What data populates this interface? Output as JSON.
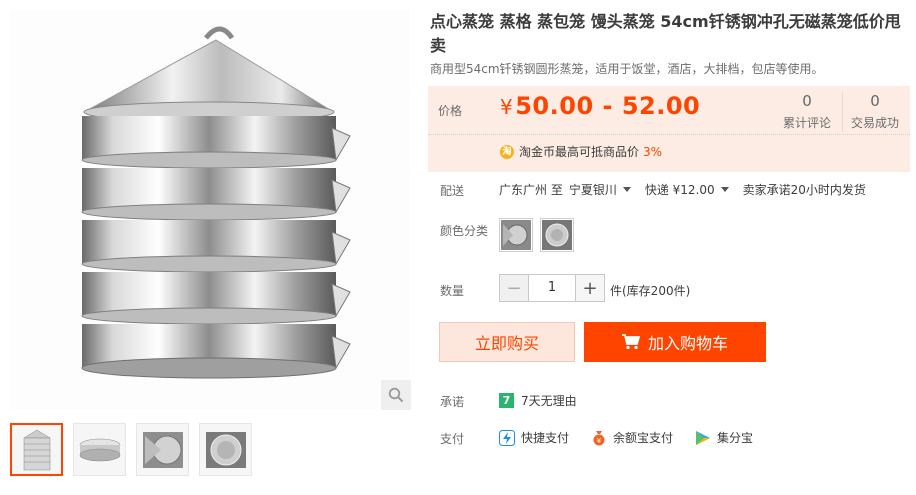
{
  "product": {
    "title": "点心蒸笼 蒸格 蒸包笼 馒头蒸笼 54cm钎锈钢冲孔无磁蒸笼低价甩卖",
    "subtitle": "商用型54cm钎锈钢圆形蒸笼，适用于饭堂，酒店，大排档，包店等使用。"
  },
  "price": {
    "label": "价格",
    "currency": "¥",
    "range": "50.00 - 52.00",
    "accent_color": "#ff4400"
  },
  "stats": {
    "reviews_count": "0",
    "reviews_label": "累计评论",
    "deals_count": "0",
    "deals_label": "交易成功"
  },
  "coin": {
    "icon": "淘",
    "text": "淘金币最高可抵商品价",
    "percent": "3%"
  },
  "shipping": {
    "label": "配送",
    "from": "广东广州 至",
    "to": "宁夏银川",
    "method": "快递 ¥12.00",
    "promise": "卖家承诺20小时内发货"
  },
  "color": {
    "label": "颜色分类"
  },
  "quantity": {
    "label": "数量",
    "minus": "−",
    "value": "1",
    "plus": "+",
    "stock": "件(库存200件)"
  },
  "actions": {
    "buy_now": "立即购买",
    "add_to_cart": "加入购物车"
  },
  "service": {
    "label": "承诺",
    "badge": "7",
    "text": "7天无理由"
  },
  "payment": {
    "label": "支付",
    "methods": [
      "快捷支付",
      "余额宝支付",
      "集分宝"
    ]
  }
}
